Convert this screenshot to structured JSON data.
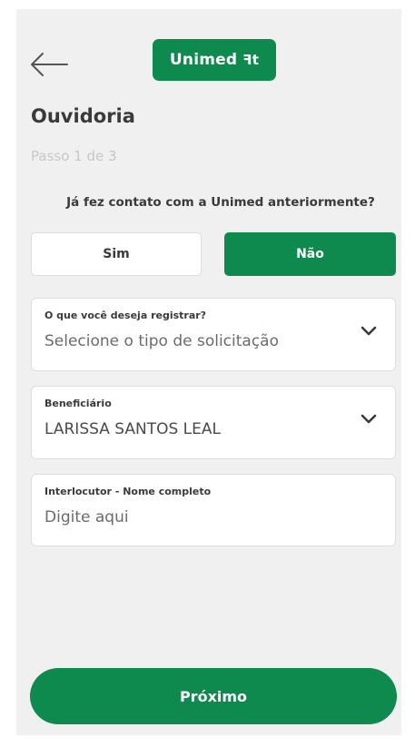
{
  "colors": {
    "brand_green": "#0e8a4f",
    "background": "#f0f0f0",
    "card": "#ffffff",
    "text": "#3a3a3a",
    "muted": "#c7c7c7"
  },
  "header": {
    "back_icon": "arrow-left-icon",
    "logo_text": "Unimed",
    "logo_mark": "ꟻt"
  },
  "page": {
    "title": "Ouvidoria",
    "step": "Passo 1 de 3",
    "question": "Já fez contato com a Unimed anteriormente?"
  },
  "options": {
    "yes": "Sim",
    "no": "Não",
    "selected": "no"
  },
  "fields": [
    {
      "label": "O que você deseja registrar?",
      "placeholder": "Selecione o tipo de solicitação",
      "type": "select",
      "icon": "chevron-down-icon"
    },
    {
      "label": "Beneficiário",
      "value": "LARISSA SANTOS LEAL",
      "type": "select",
      "icon": "chevron-down-icon"
    },
    {
      "label": "Interlocutor - Nome completo",
      "placeholder": "Digite aqui",
      "type": "text"
    }
  ],
  "footer": {
    "next_label": "Próximo"
  }
}
